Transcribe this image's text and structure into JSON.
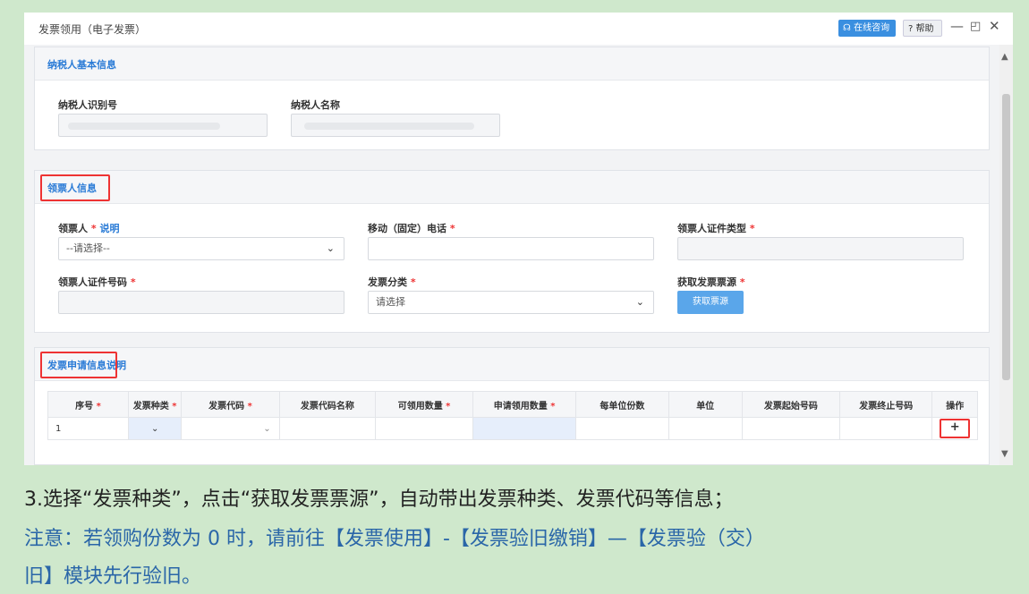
{
  "window": {
    "title": "发票领用（电子发票）",
    "online_label": "在线咨询",
    "help_label": "帮助",
    "help_prefix": "?",
    "minimize": "—",
    "maximize": "◰",
    "close": "✕"
  },
  "taxpayer_panel": {
    "title": "纳税人基本信息",
    "id_label": "纳税人识别号",
    "name_label": "纳税人名称"
  },
  "receiver_panel": {
    "title": "领票人信息",
    "receiver_label": "领票人",
    "receiver_note": "说明",
    "receiver_value": "--请选择--",
    "phone_label": "移动（固定）电话",
    "cert_type_label": "领票人证件类型",
    "cert_no_label": "领票人证件号码",
    "invoice_class_label": "发票分类",
    "invoice_class_value": "请选择",
    "get_source_label": "获取发票票源",
    "get_source_button": "获取票源",
    "required_mark": "*"
  },
  "apply_panel": {
    "title": "发票申请信息",
    "note": "说明",
    "columns": [
      "序号",
      "发票种类",
      "发票代码",
      "发票代码名称",
      "可领用数量",
      "申请领用数量",
      "每单位份数",
      "单位",
      "发票起始号码",
      "发票终止号码",
      "操作"
    ],
    "required_cols": [
      0,
      1,
      2,
      4,
      5
    ],
    "rows": [
      {
        "index": "1",
        "add": "+"
      }
    ]
  },
  "caption": {
    "line1": "3.选择“发票种类”，点击“获取发票票源”，自动带出发票种类、发票代码等信息；",
    "line2": "注意：若领购份数为 0 时，请前往【发票使用】-【发票验旧缴销】—【发票验（交）",
    "line3": "旧】模块先行验旧。"
  },
  "colors": {
    "accent": "#2a7bd6",
    "required": "#e33333",
    "background": "#cfe8cc"
  }
}
